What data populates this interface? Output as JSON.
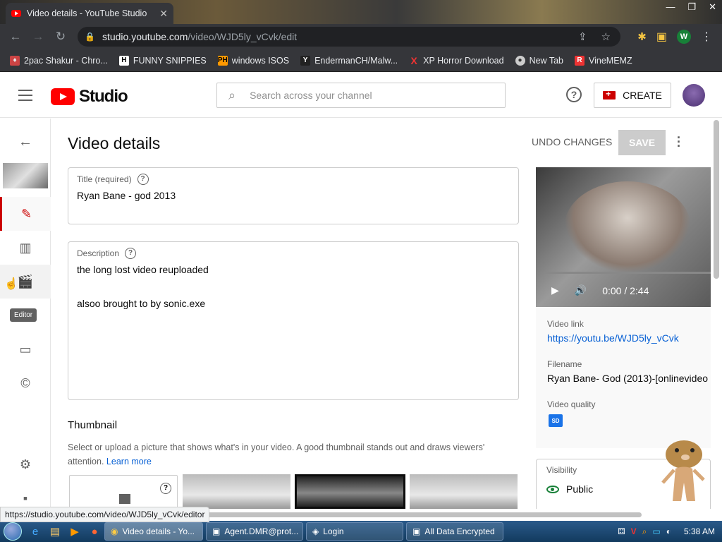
{
  "browser": {
    "tab_title": "Video details - YouTube Studio",
    "url_host": "studio.youtube.com",
    "url_path": "/video/WJD5ly_vCvk/edit",
    "profile_initial": "W"
  },
  "bookmarks": [
    {
      "icon": "bookmark-2pac-icon",
      "label": "2pac Shakur - Chro..."
    },
    {
      "icon": "bookmark-h-icon",
      "label": "FUNNY SNIPPIES"
    },
    {
      "icon": "bookmark-ph-icon",
      "label": "windows ISOS"
    },
    {
      "icon": "bookmark-yp-icon",
      "label": "EndermanCH/Malw..."
    },
    {
      "icon": "bookmark-x-icon",
      "label": "XP Horror Download"
    },
    {
      "icon": "bookmark-newtab-icon",
      "label": "New Tab"
    },
    {
      "icon": "bookmark-r-icon",
      "label": "VineMEMZ"
    }
  ],
  "header": {
    "logo_text": "Studio",
    "search_placeholder": "Search across your channel",
    "create_label": "CREATE"
  },
  "sidebar": {
    "tooltip": "Editor"
  },
  "page": {
    "title": "Video details",
    "undo_label": "UNDO CHANGES",
    "save_label": "SAVE"
  },
  "form": {
    "title_label": "Title (required)",
    "title_value": "Ryan Bane - god  2013",
    "description_label": "Description",
    "description_line1": "the long lost video reuploaded",
    "description_line2": "alsoo brought to by sonic.exe"
  },
  "thumbnail": {
    "heading": "Thumbnail",
    "desc": "Select or upload a picture that shows what's in your video. A good thumbnail stands out and draws viewers' attention.",
    "learn_more": "Learn more"
  },
  "video": {
    "time": "0:00 / 2:44",
    "link_label": "Video link",
    "link": "https://youtu.be/WJD5ly_vCvk",
    "filename_label": "Filename",
    "filename": "Ryan Bane- God (2013)-[onlinevideo",
    "quality_label": "Video quality",
    "quality_badge": "SD"
  },
  "visibility": {
    "label": "Visibility",
    "value": "Public"
  },
  "status_url": "https://studio.youtube.com/video/WJD5ly_vCvk/editor",
  "taskbar": {
    "tasks": [
      "Video details - Yo...",
      "Agent.DMR@prot...",
      "Login",
      "All Data Encrypted"
    ],
    "clock": "5:38 AM"
  }
}
